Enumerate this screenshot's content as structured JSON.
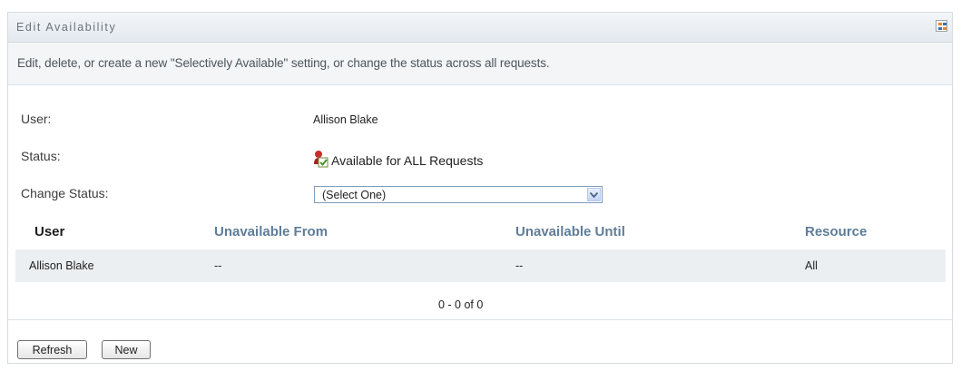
{
  "panel": {
    "title": "Edit Availability",
    "description": "Edit, delete, or create a new \"Selectively Available\" setting, or change the status across all requests."
  },
  "form": {
    "user_label": "User:",
    "user_value": "Allison Blake",
    "status_label": "Status:",
    "status_value": "Available for ALL Requests",
    "change_status_label": "Change Status:",
    "change_status_selected": "(Select One)"
  },
  "table": {
    "columns": [
      "User",
      "Unavailable From",
      "Unavailable Until",
      "Resource"
    ],
    "rows": [
      [
        "Allison Blake",
        "--",
        "--",
        "All"
      ]
    ],
    "pager": "0 - 0 of 0"
  },
  "buttons": {
    "refresh": "Refresh",
    "new": "New"
  },
  "colors": {
    "header_link": "#5f7d99",
    "row_bg": "#eceff2",
    "title_text": "#6b737a"
  },
  "icons": {
    "panel_menu": "grid-menu-icon",
    "status": "user-available-icon",
    "dropdown": "chevron-down-icon"
  }
}
